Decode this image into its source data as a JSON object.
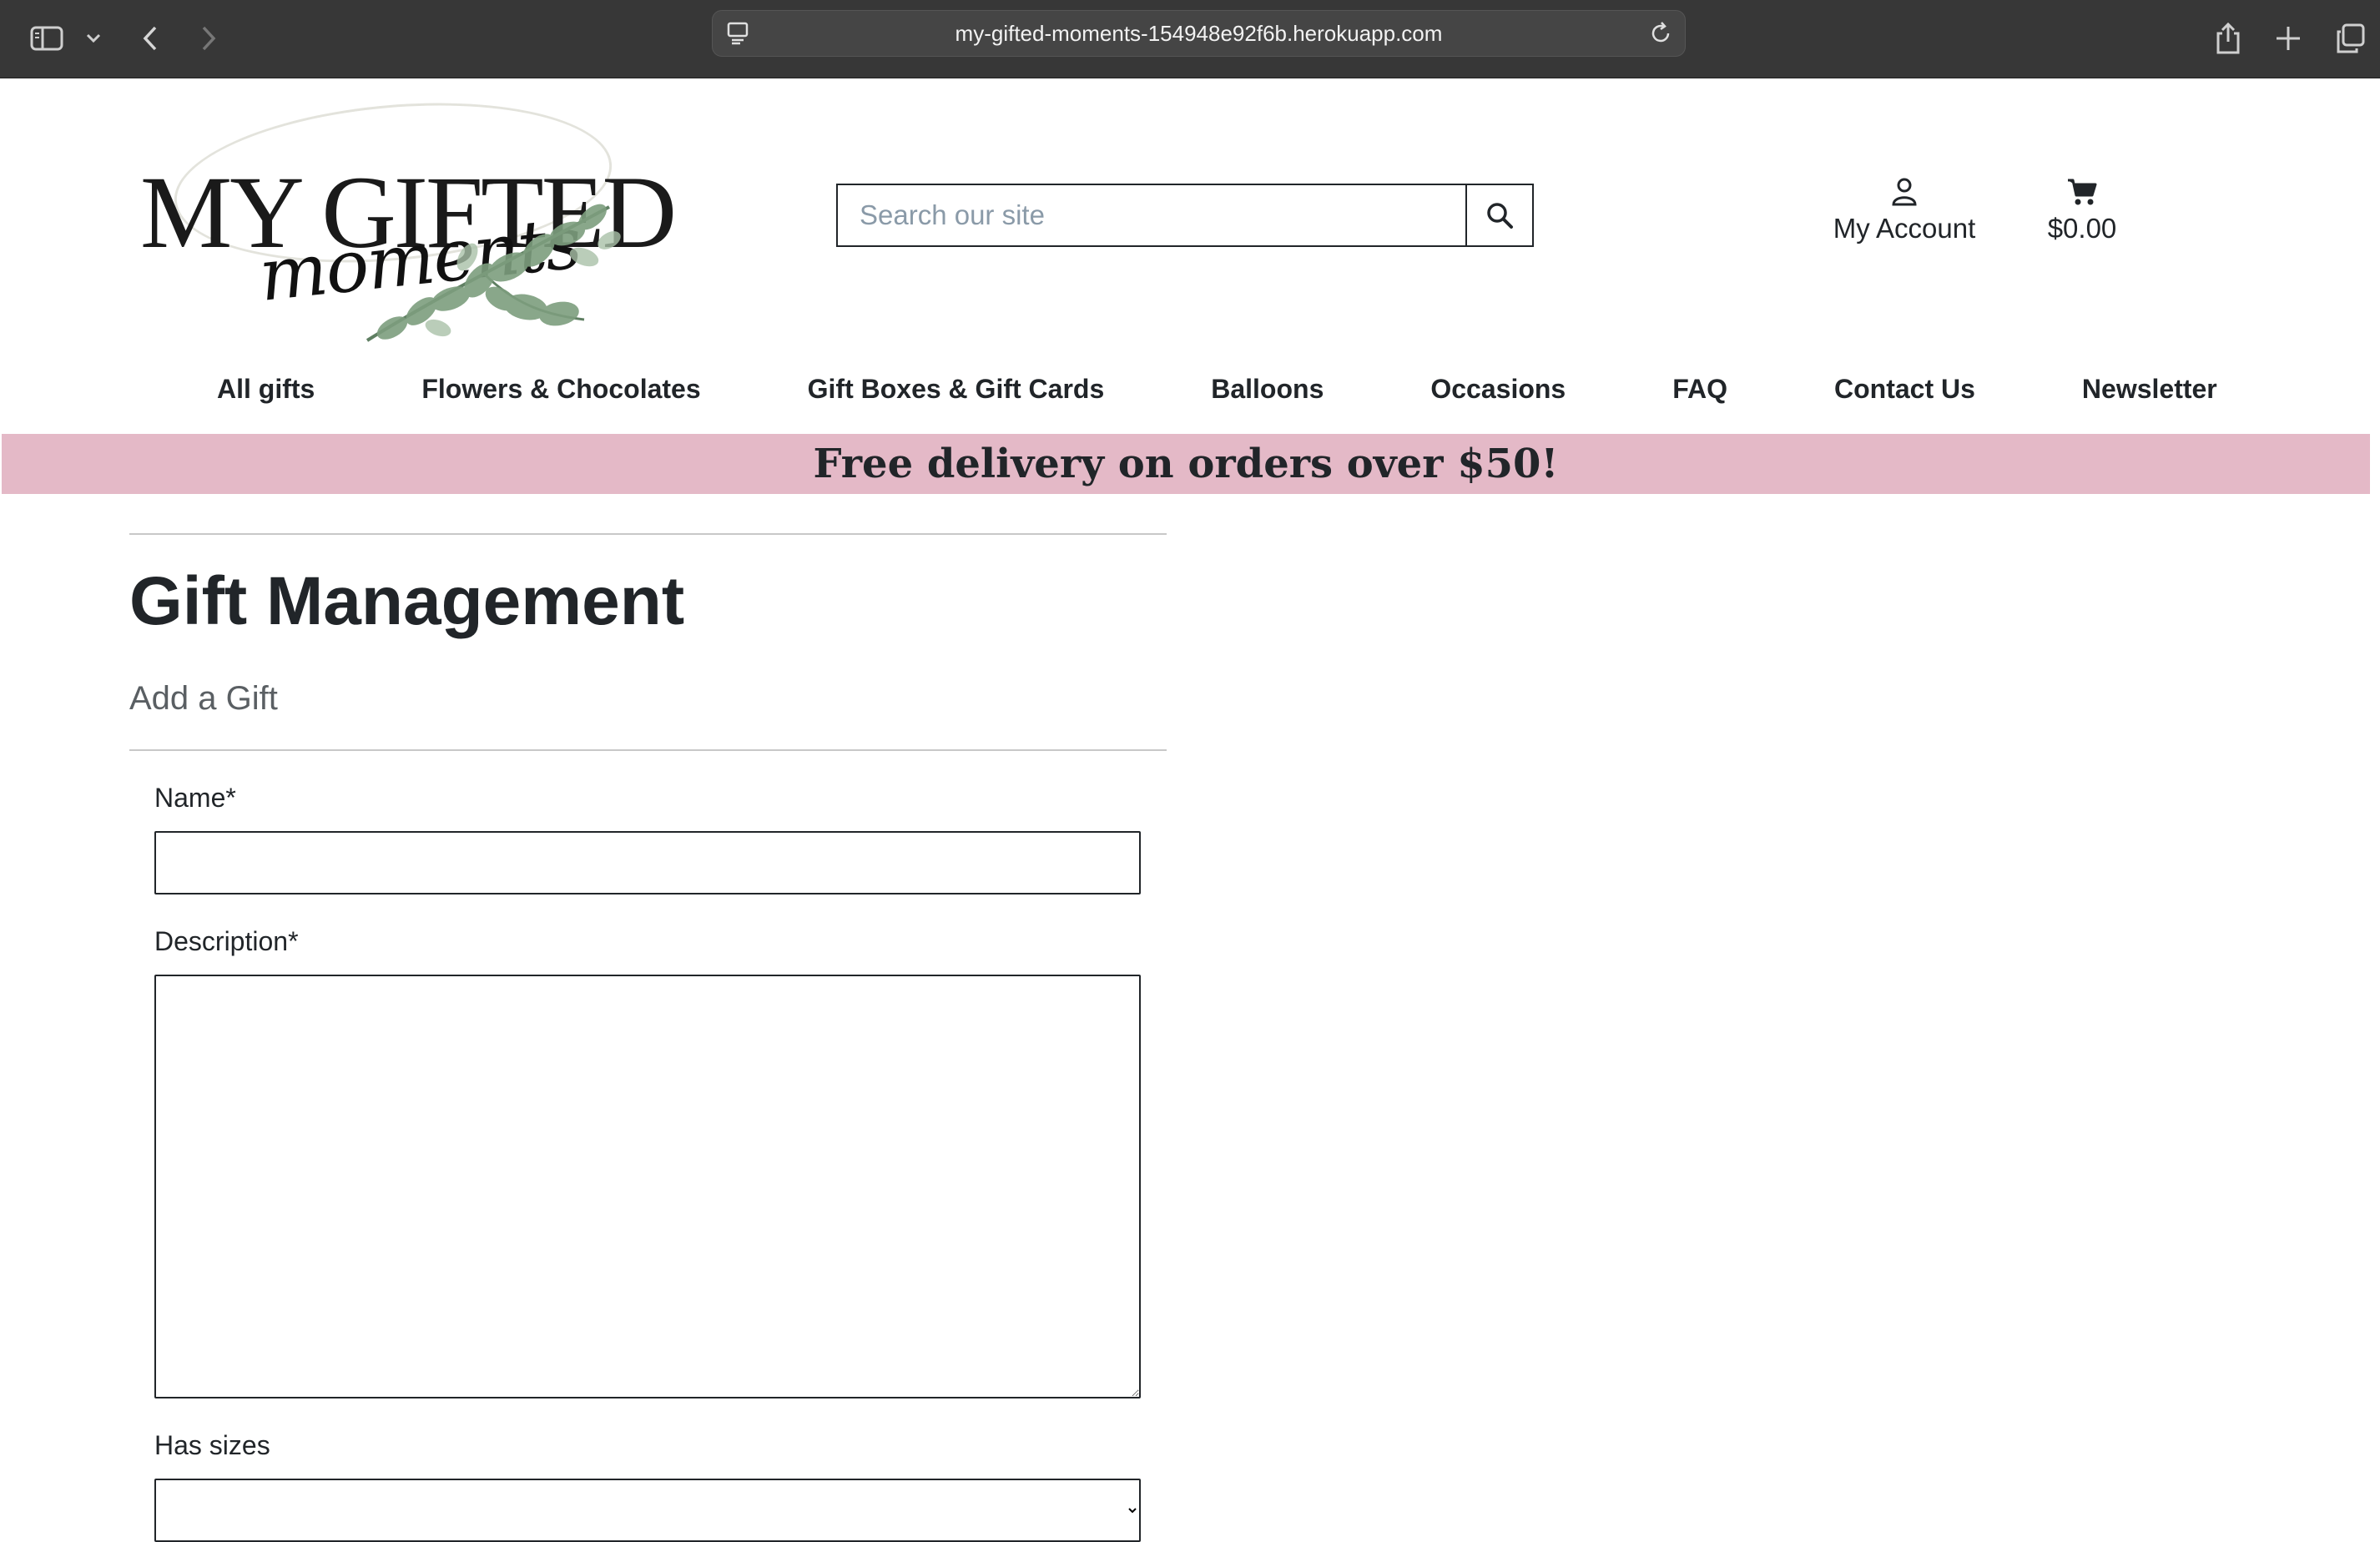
{
  "browser": {
    "url": "my-gifted-moments-154948e92f6b.herokuapp.com"
  },
  "header": {
    "logo": {
      "brand_text": "MY GIFTED",
      "script_text": "moments"
    },
    "search": {
      "placeholder": "Search our site"
    },
    "account_label": "My Account",
    "cart_total": "$0.00"
  },
  "nav": {
    "items": [
      {
        "label": "All gifts"
      },
      {
        "label": "Flowers & Chocolates"
      },
      {
        "label": "Gift Boxes & Gift Cards"
      },
      {
        "label": "Balloons"
      },
      {
        "label": "Occasions"
      },
      {
        "label": "FAQ"
      },
      {
        "label": "Contact Us"
      },
      {
        "label": "Newsletter"
      }
    ]
  },
  "banner": {
    "text": "Free delivery on orders over $50!"
  },
  "main": {
    "title": "Gift Management",
    "subtitle": "Add a Gift",
    "form": {
      "name_label": "Name*",
      "name_value": "",
      "description_label": "Description*",
      "description_value": "",
      "has_sizes_label": "Has sizes"
    }
  },
  "colors": {
    "banner": "#e4b9c7",
    "chrome": "#373737",
    "text": "#212529"
  }
}
